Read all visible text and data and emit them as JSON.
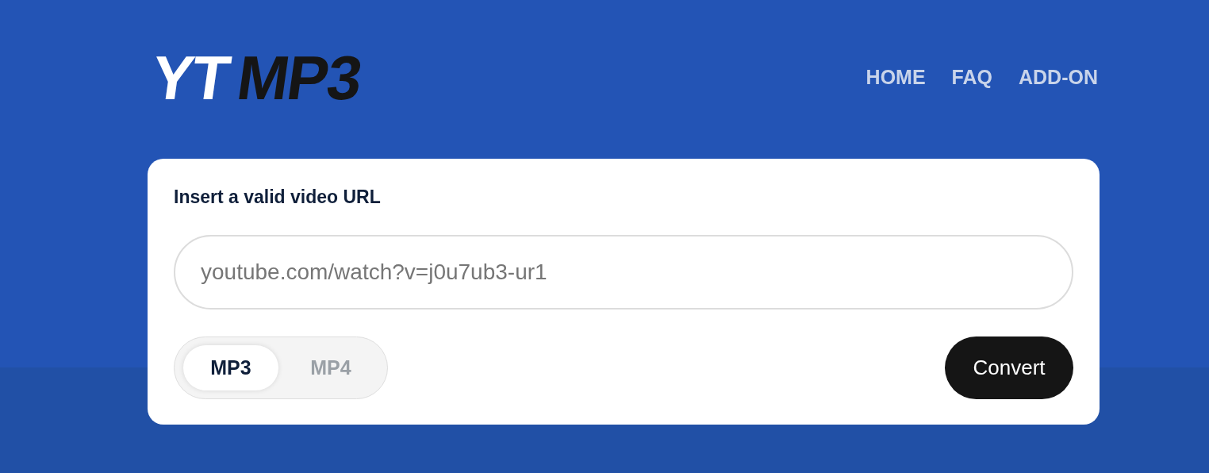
{
  "logo": [
    {
      "text": "YT",
      "kind": "light"
    },
    {
      "text": "MP3",
      "kind": "dark"
    }
  ],
  "nav": [
    "HOME",
    "FAQ",
    "ADD-ON"
  ],
  "form": {
    "label": "Insert a valid video URL",
    "url_field": {
      "placeholder": "youtube.com/watch?v=j0u7ub3-ur1"
    },
    "formats": [
      {
        "label": "MP3",
        "selected": true
      },
      {
        "label": "MP4",
        "selected": false
      }
    ],
    "button": "Convert"
  }
}
